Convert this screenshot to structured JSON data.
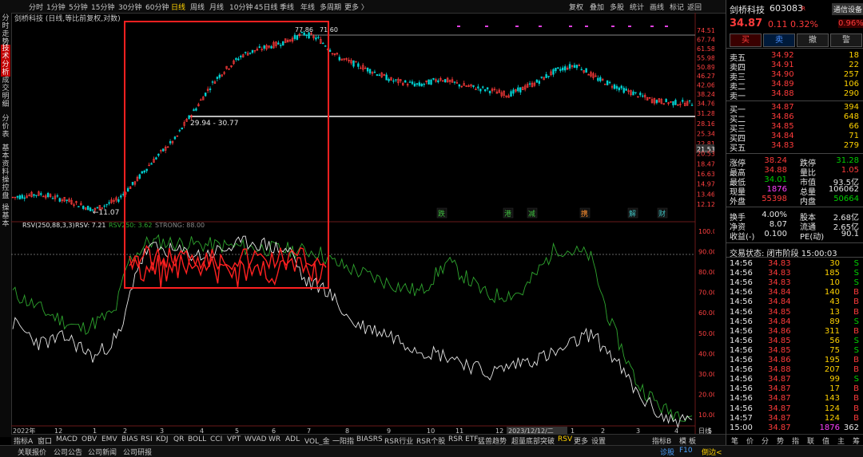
{
  "toolbar": {
    "periods": [
      "分时",
      "1分钟",
      "5分钟",
      "15分钟",
      "30分钟",
      "60分钟",
      "日线",
      "周线",
      "月线",
      "10分钟",
      "45日线",
      "季线",
      "年线",
      "多周期",
      "更多 〉"
    ],
    "active_period": "日线",
    "actions": [
      "复权",
      "叠加",
      "多股",
      "统计",
      "画线",
      "标记",
      "返回"
    ]
  },
  "left_tabs": [
    "分时走势",
    "技术分析",
    "成交明细",
    "分价表",
    "基本资料",
    "操控盘",
    "操基本"
  ],
  "active_left_tab": "技术分析",
  "chart": {
    "title": "剑桥科技 (日线,等比前复权,对数)",
    "price_axis": [
      "74.51",
      "67.74",
      "61.58",
      "55.98",
      "50.89",
      "46.27",
      "42.06",
      "38.24",
      "34.76",
      "31.28",
      "28.16",
      "25.34",
      "22.81",
      "21.53",
      "20.53",
      "18.47",
      "16.63",
      "14.97",
      "13.46",
      "12.12"
    ],
    "current_price_tag": "21.53",
    "annotations": {
      "high_label": "77.86",
      "high_label2": "71.60",
      "range_label": "29.94 - 30.77",
      "low_label": "←11.07"
    },
    "event_markers": [
      "跌",
      "港",
      "减",
      "携",
      "解",
      "财"
    ],
    "indicator_label": "RSV(250,88,3,3)",
    "indicator_values": {
      "rsv": "RSV: 7.21",
      "rsv250": "RSV250: 3.62",
      "strong": "STRONG: 88.00"
    },
    "indicator_axis": [
      "100.0",
      "90.00",
      "80.00",
      "70.00",
      "60.00",
      "50.00",
      "40.00",
      "30.00",
      "20.00",
      "10.00"
    ],
    "time_axis": [
      "2022年",
      "12",
      "1",
      "2",
      "3",
      "4",
      "5",
      "6",
      "7",
      "8",
      "9",
      "10",
      "11",
      "12",
      "2023/12/12/二",
      "1",
      "2",
      "3",
      "4",
      "5"
    ],
    "time_axis_right": "日线",
    "colors": {
      "up": "#ff3b3b",
      "down": "#00d0d0",
      "rsv": "#e6e6e6",
      "rsv250": "#2ea52e",
      "highlight": "#ff2020",
      "purple_marks": "#e040e0"
    }
  },
  "bottom_tabs": [
    "指标A",
    "窗口",
    "MACD",
    "OBV",
    "EMV",
    "BIAS",
    "RSI",
    "KDJ",
    "QR",
    "BOLL",
    "CCI",
    "VPT",
    "WVAD",
    "WR",
    "ADL",
    "VOL_金",
    "一阳指",
    "BIASRS",
    "RSR行业",
    "RSR个股",
    "RSR ETF",
    "猛兽趋势",
    "超量底部突破",
    "RSV",
    "更多",
    "设置"
  ],
  "active_bottom_tab": "RSV",
  "bottom_right": [
    "指标B",
    "模",
    "板"
  ],
  "status_bar": {
    "left": [
      "关联报价",
      "公司公告",
      "公司新闻",
      "公司研报"
    ],
    "right": [
      "诊股",
      "F10",
      "倒边<"
    ]
  },
  "stock": {
    "name": "剑桥科技",
    "code": "603083",
    "tag": "R",
    "signal_btn": "通信设备",
    "price": "34.87",
    "change": "0.11",
    "change_pct": "0.32%",
    "side_pct": "0.96%",
    "trade_buttons": [
      "买",
      "卖",
      "撤",
      "警"
    ],
    "asks": [
      {
        "label": "卖五",
        "price": "34.92",
        "vol": "18"
      },
      {
        "label": "卖四",
        "price": "34.91",
        "vol": "22"
      },
      {
        "label": "卖三",
        "price": "34.90",
        "vol": "257"
      },
      {
        "label": "卖二",
        "price": "34.89",
        "vol": "106"
      },
      {
        "label": "卖一",
        "price": "34.88",
        "vol": "290"
      }
    ],
    "bids": [
      {
        "label": "买一",
        "price": "34.87",
        "vol": "394"
      },
      {
        "label": "买二",
        "price": "34.86",
        "vol": "648"
      },
      {
        "label": "买三",
        "price": "34.85",
        "vol": "66"
      },
      {
        "label": "买四",
        "price": "34.84",
        "vol": "71"
      },
      {
        "label": "买五",
        "price": "34.83",
        "vol": "279"
      }
    ],
    "stats": [
      {
        "l1": "涨停",
        "v1": "38.24",
        "c1": "red",
        "l2": "跌停",
        "v2": "31.28",
        "c2": "green"
      },
      {
        "l1": "最高",
        "v1": "34.88",
        "c1": "red",
        "l2": "量比",
        "v2": "1.05",
        "c2": "red"
      },
      {
        "l1": "最低",
        "v1": "34.01",
        "c1": "green",
        "l2": "市值",
        "v2": "93.5亿",
        "c2": "white"
      },
      {
        "l1": "现量",
        "v1": "1876",
        "c1": "magenta",
        "l2": "总量",
        "v2": "106062",
        "c2": "white"
      },
      {
        "l1": "外盘",
        "v1": "55398",
        "c1": "red",
        "l2": "内盘",
        "v2": "50664",
        "c2": "green"
      }
    ],
    "stats2": [
      {
        "l1": "换手",
        "v1": "4.00%",
        "l2": "股本",
        "v2": "2.68亿"
      },
      {
        "l1": "净资",
        "v1": "8.07",
        "l2": "流通",
        "v2": "2.65亿"
      },
      {
        "l1": "收益(-)",
        "v1": "0.100",
        "l2": "PE(动)",
        "v2": "90.1"
      }
    ],
    "trade_status": "交易状态: 闭市阶段 15:00:03",
    "ticks": [
      {
        "t": "14:56",
        "p": "34.83",
        "v": "30",
        "d": "S"
      },
      {
        "t": "14:56",
        "p": "34.83",
        "v": "185",
        "d": "S"
      },
      {
        "t": "14:56",
        "p": "34.83",
        "v": "10",
        "d": "S"
      },
      {
        "t": "14:56",
        "p": "34.84",
        "v": "140",
        "d": "B"
      },
      {
        "t": "14:56",
        "p": "34.84",
        "v": "43",
        "d": "B"
      },
      {
        "t": "14:56",
        "p": "34.85",
        "v": "13",
        "d": "B"
      },
      {
        "t": "14:56",
        "p": "34.84",
        "v": "89",
        "d": "S"
      },
      {
        "t": "14:56",
        "p": "34.86",
        "v": "311",
        "d": "B"
      },
      {
        "t": "14:56",
        "p": "34.85",
        "v": "56",
        "d": "S"
      },
      {
        "t": "14:56",
        "p": "34.85",
        "v": "75",
        "d": "S"
      },
      {
        "t": "14:56",
        "p": "34.86",
        "v": "195",
        "d": "B"
      },
      {
        "t": "14:56",
        "p": "34.88",
        "v": "207",
        "d": "B"
      },
      {
        "t": "14:56",
        "p": "34.87",
        "v": "99",
        "d": "S"
      },
      {
        "t": "14:56",
        "p": "34.87",
        "v": "17",
        "d": "B"
      },
      {
        "t": "14:56",
        "p": "34.87",
        "v": "143",
        "d": "B"
      },
      {
        "t": "14:56",
        "p": "34.87",
        "v": "124",
        "d": "B"
      },
      {
        "t": "14:57",
        "p": "34.87",
        "v": "124",
        "d": "B"
      },
      {
        "t": "15:00",
        "p": "34.87",
        "v": "1876",
        "d": "362"
      }
    ],
    "right_tabs": [
      "笔",
      "价",
      "分",
      "势",
      "指",
      "联",
      "值",
      "主",
      "筹"
    ]
  }
}
